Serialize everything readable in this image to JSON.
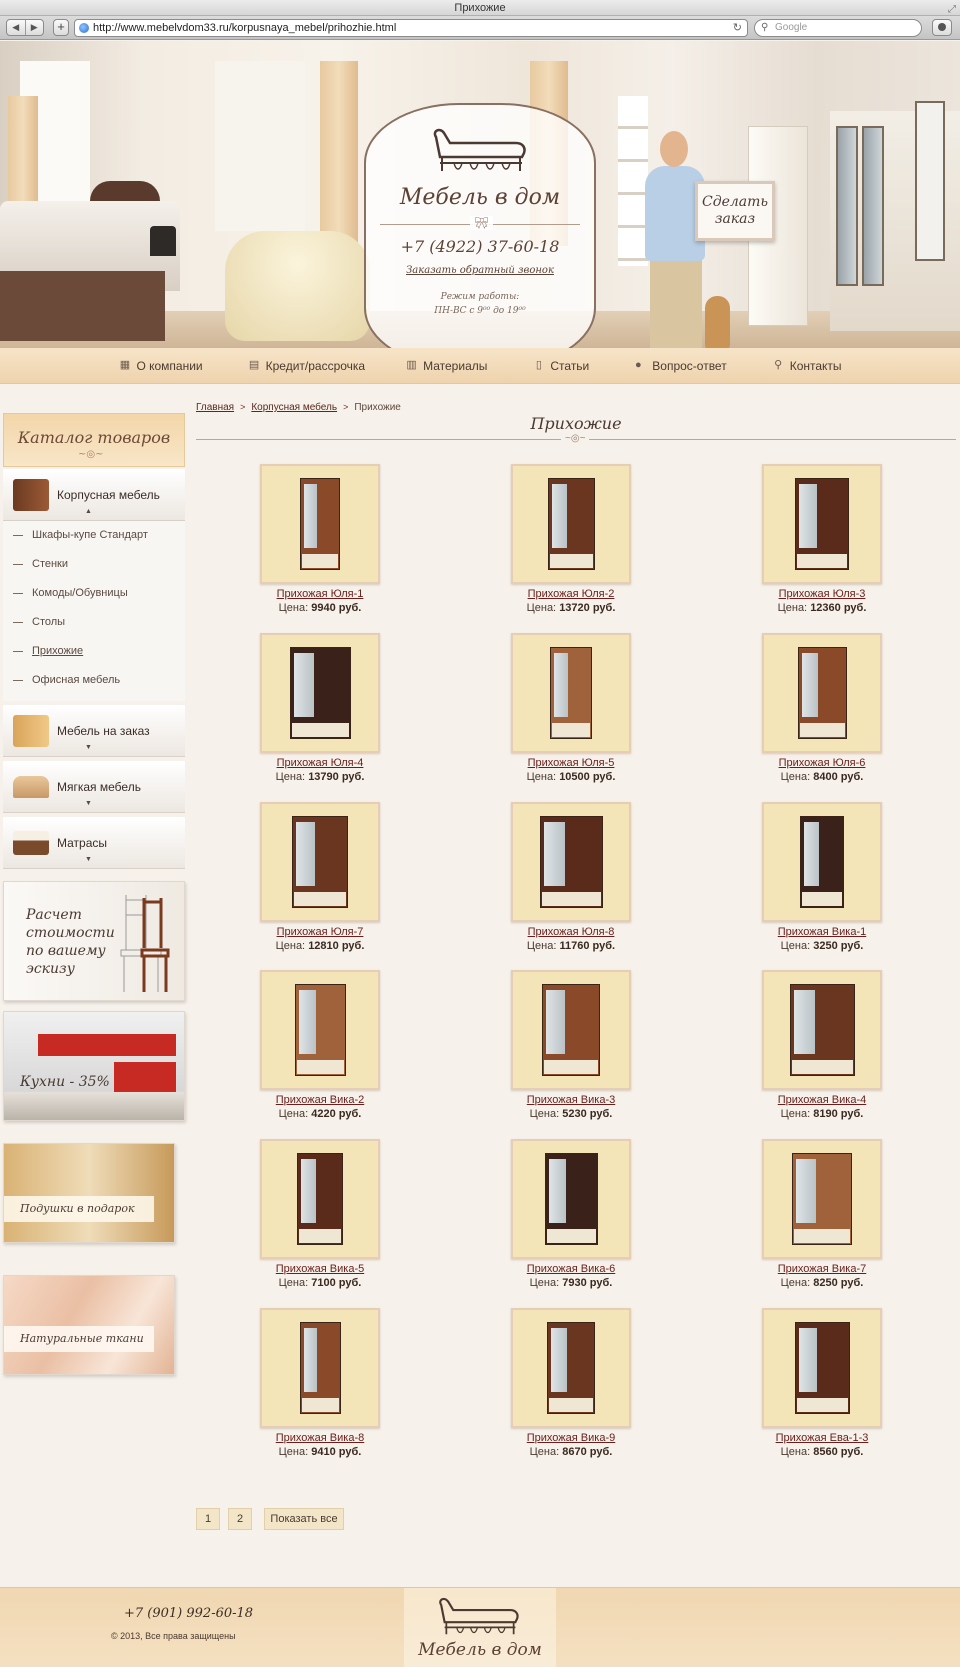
{
  "browser": {
    "window_title": "Прихожие",
    "url": "http://www.mebelvdom33.ru/korpusnaya_mebel/prihozhie.html",
    "search_placeholder": "Google"
  },
  "header": {
    "brand": "Мебель в дом",
    "phone": "+7 (4922) 37-60-18",
    "callback_link": "Заказать обратный звонок",
    "hours_line1": "Режим работы:",
    "hours_line2": "ПН-ВС с 9⁰⁰ до 19⁰⁰",
    "order_sign_line1": "Сделать",
    "order_sign_line2": "заказ"
  },
  "topnav": [
    {
      "label": "О компании",
      "icon": "building-icon"
    },
    {
      "label": "Кредит/рассрочка",
      "icon": "clipboard-icon"
    },
    {
      "label": "Материалы",
      "icon": "books-icon"
    },
    {
      "label": "Статьи",
      "icon": "document-icon"
    },
    {
      "label": "Вопрос-ответ",
      "icon": "chat-bubbles-icon"
    },
    {
      "label": "Контакты",
      "icon": "map-pin-icon"
    }
  ],
  "sidebar": {
    "catalog_title": "Каталог товаров",
    "main_category": "Корпусная мебель",
    "subitems": [
      "Шкафы-купе Стандарт",
      "Стенки",
      "Комоды/Обувницы",
      "Столы",
      "Прихожие",
      "Офисная мебель"
    ],
    "active_subitem": "Прихожие",
    "categories": [
      "Мебель на заказ",
      "Мягкая мебель",
      "Матрасы"
    ],
    "promos": {
      "sketch_line1": "Расчет",
      "sketch_line2": "стоимости",
      "sketch_line3": "по вашему",
      "sketch_line4": "эскизу",
      "kitchens": "Кухни - 35%",
      "pillows": "Подушки в подарок",
      "fabrics": "Натуральные ткани"
    }
  },
  "breadcrumb": {
    "home": "Главная",
    "section": "Корпусная мебель",
    "current": "Прихожие",
    "separator": ">"
  },
  "page_title": "Прихожие",
  "price_label": "Цена:",
  "products": [
    {
      "name": "Прихожая Юля-1",
      "price": "9940 руб."
    },
    {
      "name": "Прихожая Юля-2",
      "price": "13720 руб."
    },
    {
      "name": "Прихожая Юля-3",
      "price": "12360 руб."
    },
    {
      "name": "Прихожая Юля-4",
      "price": "13790 руб."
    },
    {
      "name": "Прихожая Юля-5",
      "price": "10500 руб."
    },
    {
      "name": "Прихожая Юля-6",
      "price": "8400 руб."
    },
    {
      "name": "Прихожая Юля-7",
      "price": "12810 руб."
    },
    {
      "name": "Прихожая Юля-8",
      "price": "11760 руб."
    },
    {
      "name": "Прихожая Вика-1",
      "price": "3250 руб."
    },
    {
      "name": "Прихожая Вика-2",
      "price": "4220 руб."
    },
    {
      "name": "Прихожая Вика-3",
      "price": "5230 руб."
    },
    {
      "name": "Прихожая Вика-4",
      "price": "8190 руб."
    },
    {
      "name": "Прихожая Вика-5",
      "price": "7100 руб."
    },
    {
      "name": "Прихожая Вика-6",
      "price": "7930 руб."
    },
    {
      "name": "Прихожая Вика-7",
      "price": "8250 руб."
    },
    {
      "name": "Прихожая Вика-8",
      "price": "9410 руб."
    },
    {
      "name": "Прихожая Вика-9",
      "price": "8670 руб."
    },
    {
      "name": "Прихожая Ева-1-3",
      "price": "8560 руб."
    }
  ],
  "pagination": {
    "pages": [
      "1",
      "2"
    ],
    "show_all": "Показать все"
  },
  "footer": {
    "phone": "+7 (901) 992-60-18",
    "copyright": "© 2013, Все права защищены",
    "brand": "Мебель в дом"
  }
}
